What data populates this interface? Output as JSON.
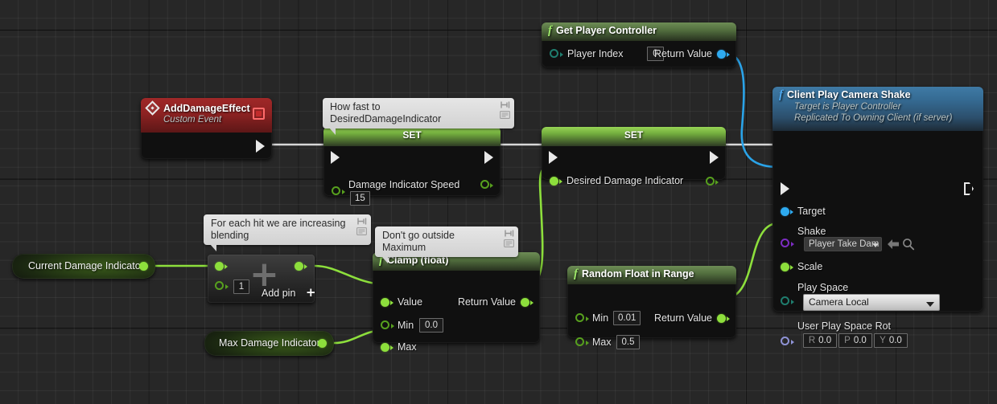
{
  "graph": {
    "background_color": "#272727",
    "grid_line_color": "#3a3a3a"
  },
  "nodes": {
    "add_damage_effect": {
      "title": "AddDamageEffect",
      "subtitle": "Custom Event",
      "header_color": "#8f1d1d",
      "icon": "event-diamond-icon"
    },
    "set_damage_indicator_speed": {
      "title": "SET",
      "header_color": "#74c241",
      "pin_label": "Damage Indicator Speed",
      "value": "15"
    },
    "set_desired_damage_indicator": {
      "title": "SET",
      "header_color": "#74c241",
      "pin_label": "Desired Damage Indicator"
    },
    "get_player_controller": {
      "title": "Get Player Controller",
      "header_color": "#5f7a4a",
      "input_label": "Player Index",
      "input_value": "0",
      "output_label": "Return Value"
    },
    "client_play_camera_shake": {
      "title": "Client Play Camera Shake",
      "subtitle_line1": "Target is Player Controller",
      "subtitle_line2": "Replicated To Owning Client (if server)",
      "header_color": "#35678f",
      "target_label": "Target",
      "shake_label": "Shake",
      "shake_value": "Player Take Dam",
      "scale_label": "Scale",
      "play_space_label": "Play Space",
      "play_space_value": "Camera Local",
      "user_play_space_rot_label": "User Play Space Rot",
      "rot_r_axis": "R",
      "rot_r_value": "0.0",
      "rot_p_axis": "P",
      "rot_p_value": "0.0",
      "rot_y_axis": "Y",
      "rot_y_value": "0.0"
    },
    "clamp_float": {
      "title": "Clamp (float)",
      "header_color": "#4e7c37",
      "value_label": "Value",
      "min_label": "Min",
      "min_value": "0.0",
      "max_label": "Max",
      "return_label": "Return Value"
    },
    "random_float_in_range": {
      "title": "Random Float in Range",
      "header_color": "#4e7c37",
      "min_label": "Min",
      "min_value": "0.01",
      "max_label": "Max",
      "max_value": "0.5",
      "return_label": "Return Value"
    },
    "add_node": {
      "value": "1",
      "add_pin_label": "Add pin",
      "add_pin_plus": "+",
      "plus_glyph": "+"
    },
    "current_damage_indicator": {
      "label": "Current Damage Indicator"
    },
    "max_damage_indicator": {
      "label": "Max Damage Indicator"
    }
  },
  "comments": {
    "how_fast": "How fast to DesiredDamageIndicator",
    "for_each_hit": "For each hit we are increasing blending",
    "dont_go_outside": "Don't go outside Maximum"
  }
}
